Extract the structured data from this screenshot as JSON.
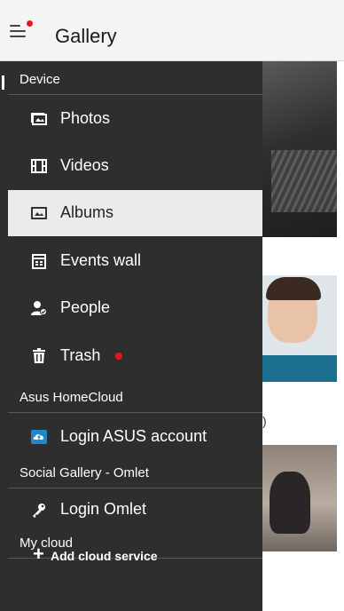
{
  "app_bar": {
    "title": "Gallery",
    "menu_icon": "hamburger-menu-icon",
    "notification_dot_color": "#e8161c"
  },
  "drawer": {
    "sections": [
      {
        "label": "Device",
        "items": [
          {
            "label": "Photos",
            "icon": "photos-icon"
          },
          {
            "label": "Videos",
            "icon": "film-icon"
          },
          {
            "label": "Albums",
            "icon": "album-icon",
            "selected": true
          },
          {
            "label": "Events wall",
            "icon": "calendar-icon"
          },
          {
            "label": "People",
            "icon": "person-check-icon"
          },
          {
            "label": "Trash",
            "icon": "trash-icon",
            "badge": true
          }
        ]
      },
      {
        "label": "Asus HomeCloud",
        "items": [
          {
            "label": "Login ASUS account",
            "icon": "asus-cloud-icon"
          }
        ]
      },
      {
        "label": "Social Gallery - Omlet",
        "items": [
          {
            "label": "Login Omlet",
            "icon": "key-icon"
          }
        ]
      },
      {
        "label": "My cloud",
        "items": []
      }
    ],
    "add_cloud": {
      "label": "Add cloud service",
      "icon": "plus-icon"
    }
  },
  "background": {
    "partial_char": ")"
  },
  "colors": {
    "drawer_bg": "#2e2e2e",
    "selected_bg": "#ebebeb",
    "app_bar_bg": "#f4f4f4",
    "asus_icon_blue": "#1e88c8"
  }
}
